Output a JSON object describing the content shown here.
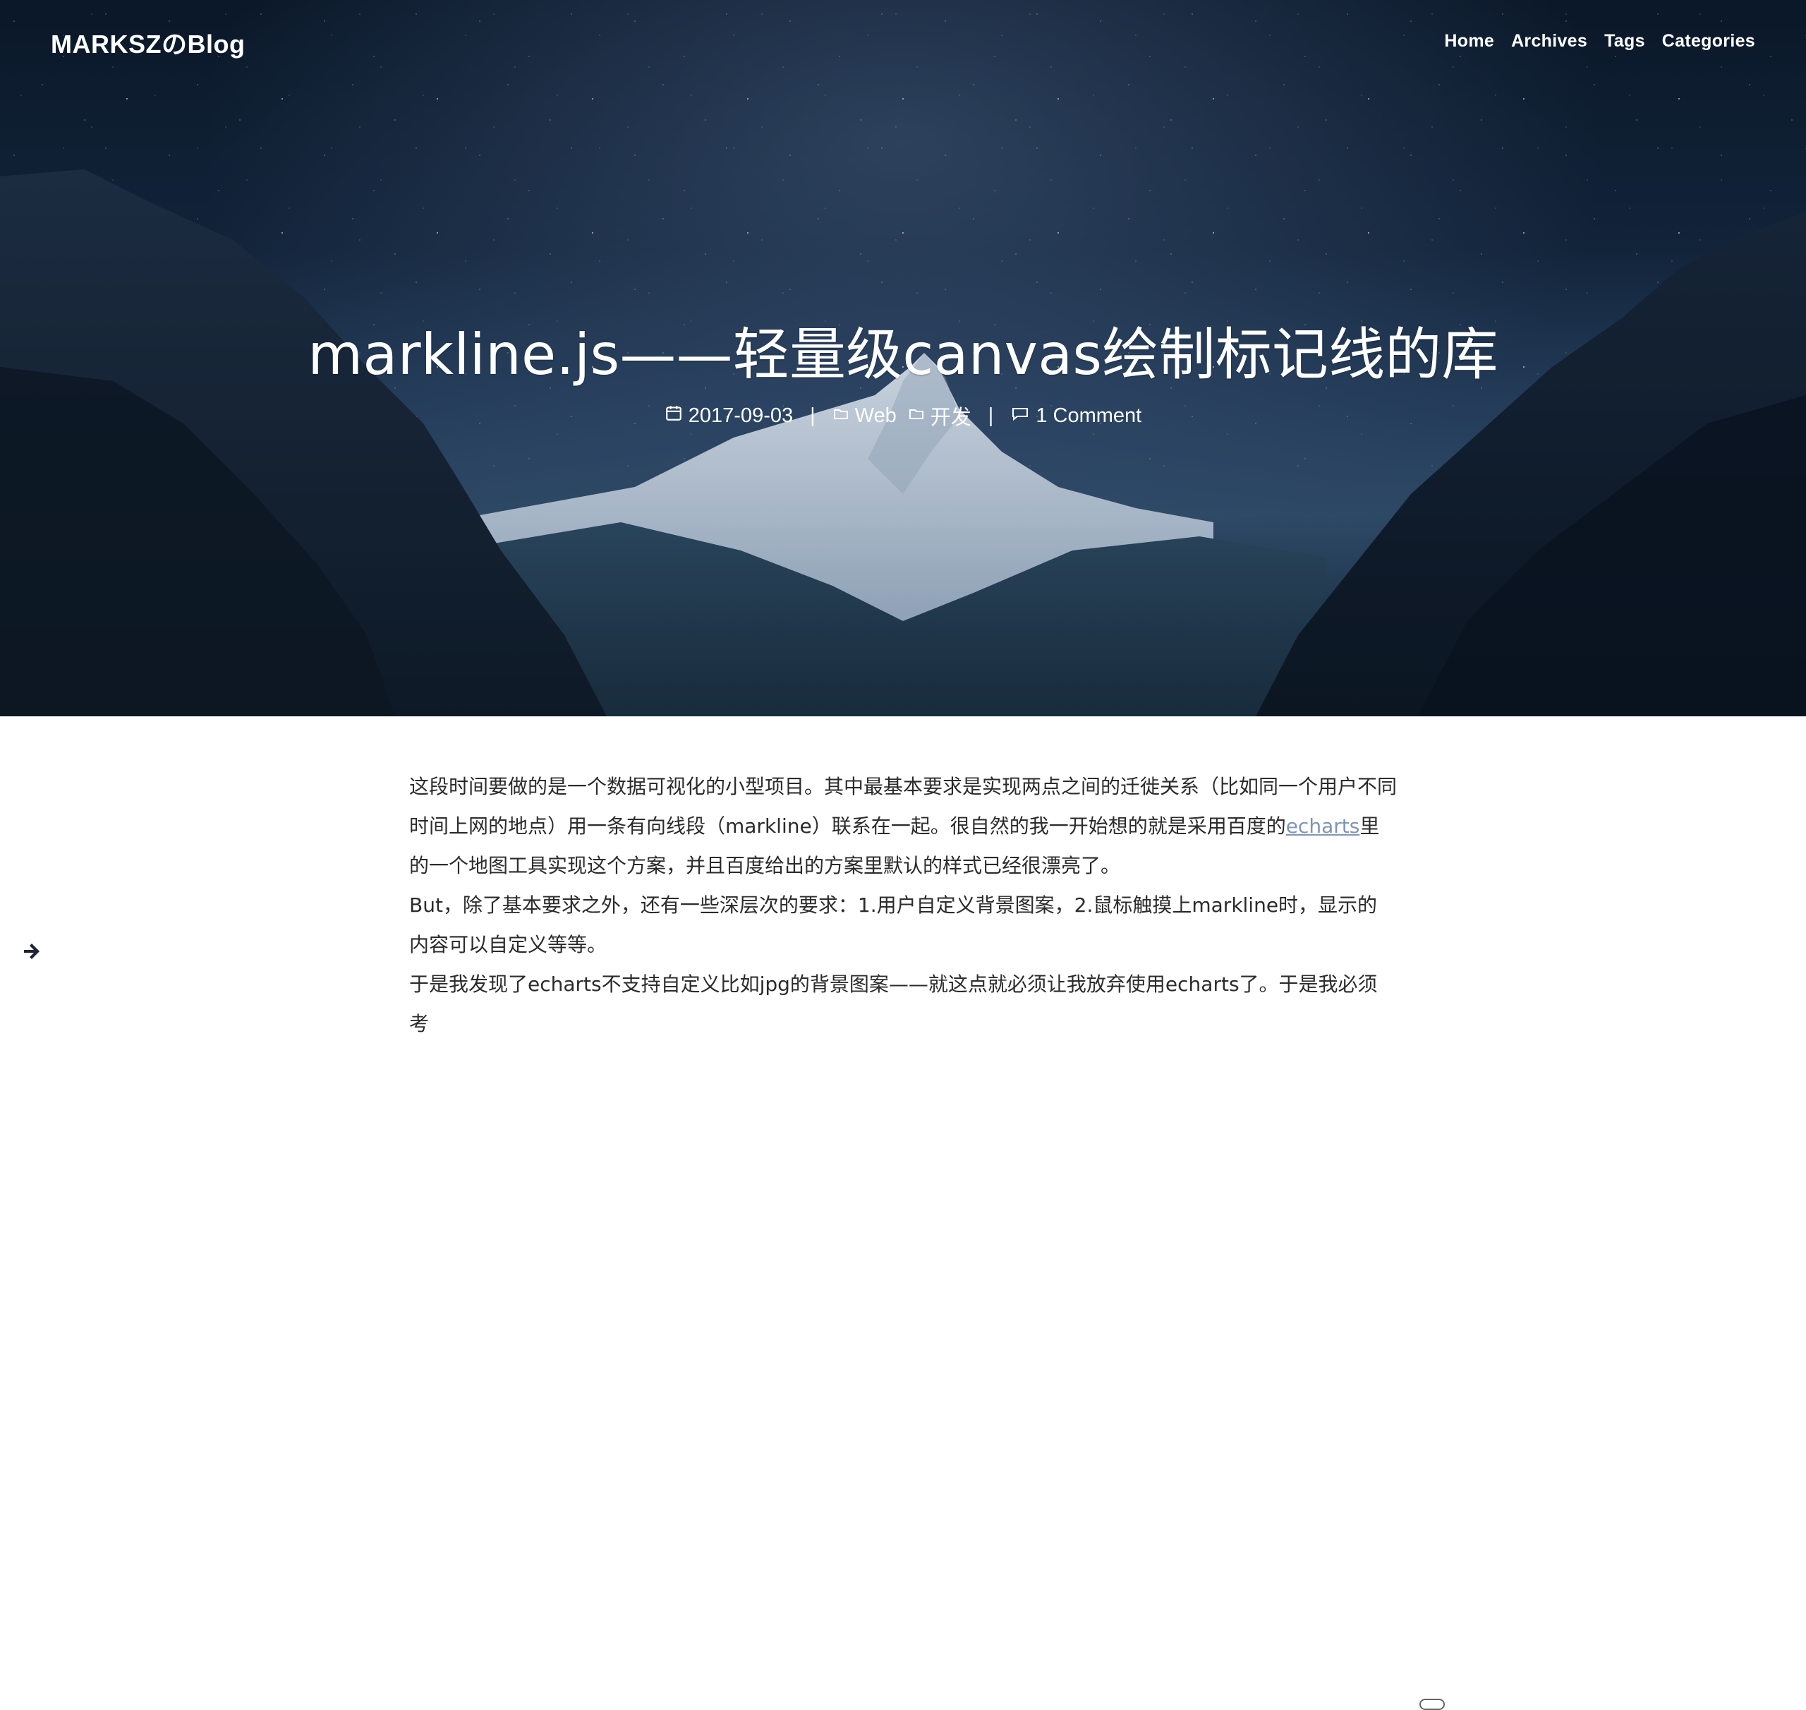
{
  "nav": {
    "brand": "MARKSZのBlog",
    "links": [
      {
        "label": "Home"
      },
      {
        "label": "Archives"
      },
      {
        "label": "Tags"
      },
      {
        "label": "Categories"
      }
    ]
  },
  "hero": {
    "title": "markline.js——轻量级canvas绘制标记线的库",
    "meta": {
      "date": "2017-09-03",
      "category_1": "Web",
      "category_2": "开发",
      "comments": "1 Comment",
      "separator": "|"
    }
  },
  "article": {
    "p1_before_link": "这段时间要做的是一个数据可视化的小型项目。其中最基本要求是实现两点之间的迁徙关系（比如同一个用户不同时间上网的地点）用一条有向线段（markline）联系在一起。很自然的我一开始想的就是采用百度的",
    "p1_link": "echarts",
    "p1_after_link": "里的一个地图工具实现这个方案，并且百度给出的方案里默认的样式已经很漂亮了。",
    "p2": "But，除了基本要求之外，还有一些深层次的要求：1.用户自定义背景图案，2.鼠标触摸上markline时，显示的内容可以自定义等等。",
    "p3": "于是我发现了echarts不支持自定义比如jpg的背景图案——就这点就必须让我放弃使用echarts了。于是我必须考"
  },
  "icons": {
    "calendar": "calendar-icon",
    "folder": "folder-icon",
    "comment": "comment-icon",
    "arrow": "arrow-right-icon"
  },
  "colors": {
    "link": "#7f95b3",
    "text": "#2b2b2b",
    "hero_text": "#ffffff"
  }
}
